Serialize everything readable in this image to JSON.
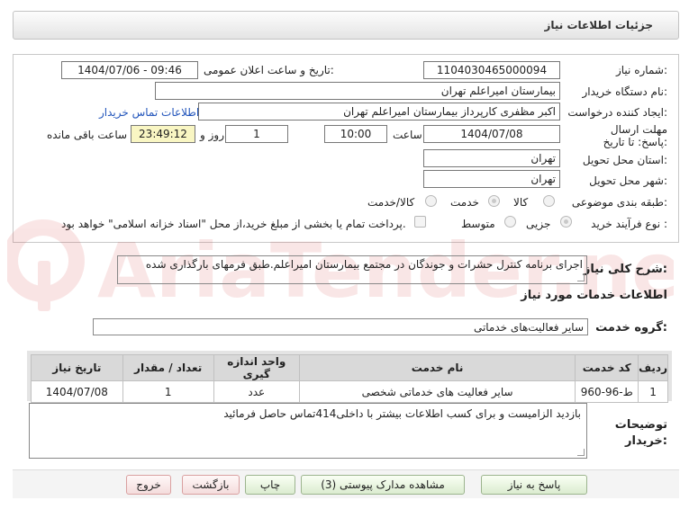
{
  "header": {
    "title": "جزئیات اطلاعات نیاز"
  },
  "form": {
    "need_number_label": "شماره نیاز:",
    "need_number": "1104030465000094",
    "announce_label": "تاریخ و ساعت اعلان عمومی:",
    "announce_value": "1404/07/06 - 09:46",
    "buyer_org_label": "نام دستگاه خریدار:",
    "buyer_org": "بیمارستان امیراعلم تهران",
    "creator_label": "ایجاد کننده درخواست:",
    "creator": "اکبر مظفری کارپرداز بیمارستان امیراعلم تهران",
    "contact_link": "اطلاعات تماس خریدار",
    "deadline_label": "مهلت ارسال پاسخ: تا تاریخ:",
    "deadline_date": "1404/07/08",
    "time_label": "ساعت",
    "deadline_time": "10:00",
    "days_value": "1",
    "days_label": "روز و",
    "remaining": "23:49:12",
    "remaining_label": "ساعت باقی مانده",
    "province_label": "استان محل تحویل:",
    "province": "تهران",
    "city_label": "شهر محل تحویل:",
    "city": "تهران",
    "category_label": "طبقه بندی موضوعی:",
    "category_options": [
      "کالا",
      "خدمت",
      "کالا/خدمت"
    ],
    "purchase_label": "نوع فرآیند خرید :",
    "purchase_options": [
      "جزیی",
      "متوسط"
    ],
    "payment_note": "پرداخت تمام یا بخشی از مبلغ خرید،از محل \"اسناد خزانه اسلامی\" خواهد بود."
  },
  "desc": {
    "label": "شرح کلی نیاز:",
    "value": "اجرای برنامه کنترل حشرات و جوندگان در مجتمع بیمارستان امیراعلم.طبق فرمهای بارگذاری شده"
  },
  "services": {
    "title": "اطلاعات خدمات مورد نیاز",
    "group_label": "گروه خدمت:",
    "group_value": "سایر فعالیت‌های خدماتی",
    "columns": [
      "ردیف",
      "کد خدمت",
      "نام خدمت",
      "واحد اندازه گیری",
      "تعداد / مقدار",
      "تاریخ نیاز"
    ],
    "rows": [
      [
        "1",
        "ط-96-960",
        "سایر فعالیت های خدماتی شخصی",
        "عدد",
        "1",
        "1404/07/08"
      ]
    ]
  },
  "buyer_notes": {
    "label": "توضیحات خریدار:",
    "value": "بازدید الزامیست و برای کسب اطلاعات بیشتر با داخلی414تماس حاصل فرمائید"
  },
  "watermark": "AriaTender.net",
  "buttons": {
    "reply": "پاسخ به نیاز",
    "attachments": "مشاهده مدارک پیوستی (3)",
    "print": "چاپ",
    "back": "بازگشت",
    "exit": "خروج"
  },
  "colors": {
    "link": "#2255bb",
    "remaining_bg": "#f9f6c3",
    "watermark": "#d63a3a"
  }
}
